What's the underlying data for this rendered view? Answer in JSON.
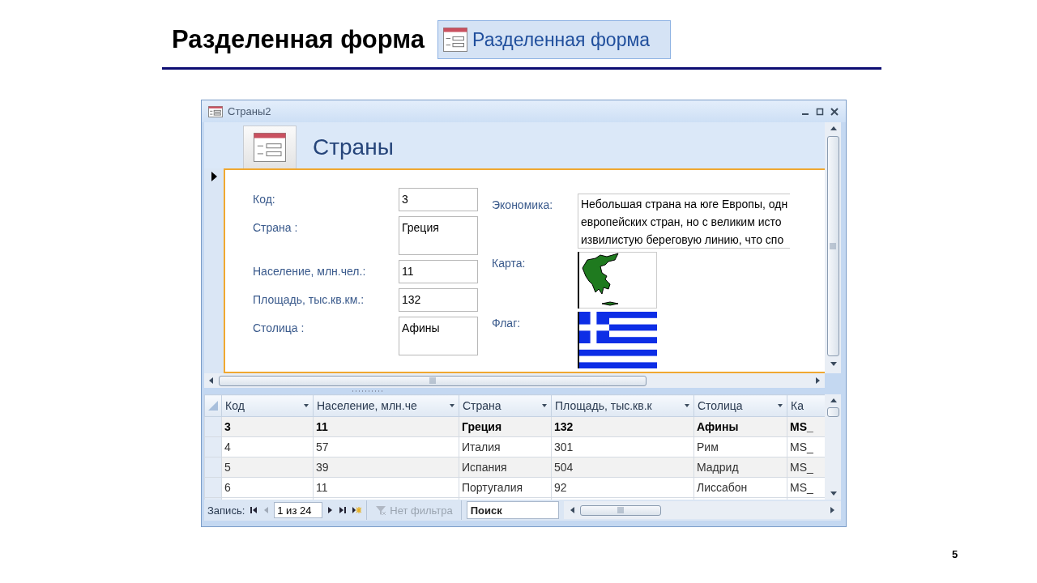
{
  "slide": {
    "title": "Разделенная форма",
    "command_button": {
      "label": "Разделенная форма"
    },
    "page_number": "5"
  },
  "window": {
    "title": "Страны2"
  },
  "form": {
    "title": "Страны",
    "fields": [
      {
        "label": "Код:",
        "value": "3",
        "kind": "short"
      },
      {
        "label": "Страна :",
        "value": "Греция",
        "kind": "tall"
      },
      {
        "label": "Население, млн.чел.:",
        "value": "11",
        "kind": "short"
      },
      {
        "label": "Площадь, тыс.кв.км.:",
        "value": "132",
        "kind": "short"
      },
      {
        "label": "Столица :",
        "value": "Афины",
        "kind": "tall"
      }
    ],
    "memo": {
      "label": "Экономика:",
      "lines": [
        "Небольшая страна на юге Европы, одн",
        "европейских стран, но с великим исто",
        "извилистую береговую линию, что спо"
      ]
    },
    "pictures": [
      {
        "label": "Карта:",
        "kind": "map"
      },
      {
        "label": "Флаг:",
        "kind": "flag"
      }
    ]
  },
  "datasheet": {
    "columns": [
      "Код",
      "Население, млн.че",
      "Страна",
      "Площадь, тыс.кв.к",
      "Столица",
      "Ка"
    ],
    "rows": [
      {
        "cells": [
          "3",
          "11",
          "Греция",
          "132",
          "Афины",
          "MS_"
        ],
        "selected": true
      },
      {
        "cells": [
          "4",
          "57",
          "Италия",
          "301",
          "Рим",
          "MS_"
        ],
        "selected": false
      },
      {
        "cells": [
          "5",
          "39",
          "Испания",
          "504",
          "Мадрид",
          "MS_"
        ],
        "selected": false
      },
      {
        "cells": [
          "6",
          "11",
          "Португалия",
          "92",
          "Лиссабон",
          "MS_"
        ],
        "selected": false
      }
    ]
  },
  "navigation": {
    "label": "Запись:",
    "position": "1 из 24",
    "filter": {
      "label": "Нет фильтра",
      "disabled": true
    },
    "search": {
      "placeholder": "Поиск"
    }
  }
}
